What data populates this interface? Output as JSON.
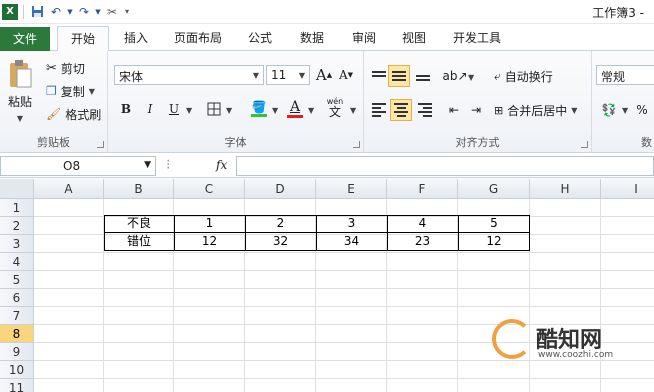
{
  "window": {
    "title": "工作簿3 -"
  },
  "ribbon_tabs": [
    "文件",
    "开始",
    "插入",
    "页面布局",
    "公式",
    "数据",
    "审阅",
    "视图",
    "开发工具"
  ],
  "clipboard": {
    "paste": "粘贴",
    "cut": "剪切",
    "copy": "复制",
    "format_painter": "格式刷",
    "group": "剪贴板"
  },
  "font": {
    "name": "宋体",
    "size": "11",
    "group": "字体",
    "bold": "B",
    "italic": "I",
    "underline": "U",
    "grow": "A",
    "shrink": "A",
    "phonetic": "wén"
  },
  "alignment": {
    "wrap": "自动换行",
    "merge": "合并后居中",
    "group": "对齐方式"
  },
  "number": {
    "format": "常规",
    "percent": "%",
    "group": "数"
  },
  "formula_bar": {
    "name_box": "O8",
    "fx": "fx",
    "value": ""
  },
  "columns": [
    "A",
    "B",
    "C",
    "D",
    "E",
    "F",
    "G",
    "H",
    "I"
  ],
  "rows": [
    "1",
    "2",
    "3",
    "4",
    "5",
    "6",
    "7",
    "8",
    "9",
    "10",
    "11"
  ],
  "selected_row": "8",
  "table": {
    "row2": {
      "label": "不良",
      "values": [
        "1",
        "2",
        "3",
        "4",
        "5"
      ]
    },
    "row3": {
      "label": "错位",
      "values": [
        "12",
        "32",
        "34",
        "23",
        "12"
      ]
    }
  },
  "watermark": {
    "brand": "酷知网",
    "url": "www.coozhi.com"
  },
  "colors": {
    "file_tab": "#2b7a3c",
    "selected_row_header": "#f9d67c",
    "accent": "#2b5797"
  }
}
